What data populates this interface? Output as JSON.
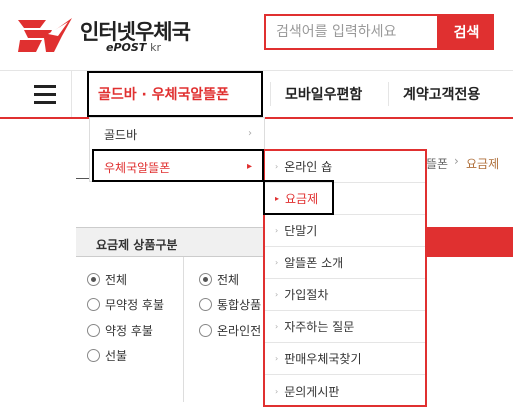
{
  "header": {
    "logo_title": "인터넷우체국",
    "logo_sub": "ePOST",
    "logo_sub_kr": "kr",
    "search_placeholder": "검색어를 입력하세요",
    "search_button": "검색"
  },
  "gnb": {
    "items": [
      "골드바 · 우체국알뜰폰",
      "모바일우편함",
      "계약고객전용"
    ]
  },
  "dropdown_level1": {
    "items": [
      {
        "label": "골드바",
        "arrow": "›"
      },
      {
        "label": "우체국알뜰폰",
        "arrow": "▸"
      }
    ]
  },
  "dropdown_level2": {
    "items": [
      "온라인 숍",
      "요금제",
      "단말기",
      "알뜰폰 소개",
      "가입절차",
      "자주하는 질문",
      "판매우체국찾기",
      "문의게시판"
    ]
  },
  "breadcrumb": {
    "partial": "뜰폰",
    "sep": "›",
    "current": "요금제"
  },
  "filter": {
    "title": "요금제 상품구분",
    "col1": [
      "전체",
      "무약정 후불",
      "약정 후불",
      "선불"
    ],
    "col2": [
      "전체",
      "통합상품",
      "온라인전"
    ]
  },
  "colors": {
    "accent": "#e03030",
    "breadcrumb_current": "#b0713d"
  }
}
